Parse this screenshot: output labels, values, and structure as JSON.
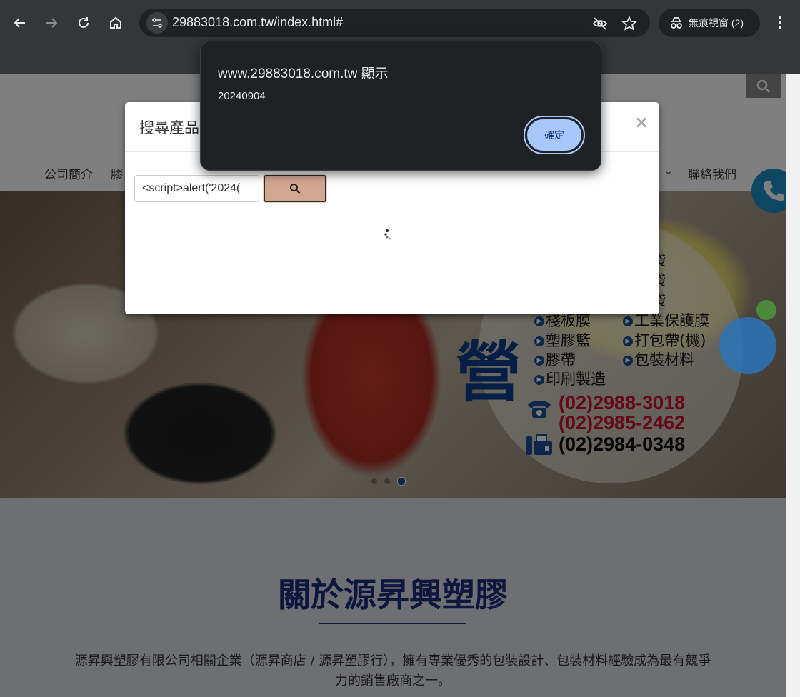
{
  "browser": {
    "url": "29883018.com.tw/index.html#",
    "incognito_label": "無痕視窗 (2)",
    "icons": [
      "back-icon",
      "forward-icon",
      "reload-icon",
      "home-icon",
      "site-info-icon",
      "eye-off-icon",
      "star-icon",
      "incognito-icon",
      "more-icon"
    ]
  },
  "site": {
    "nav": [
      "公司簡介",
      "膠",
      "聯絡我們"
    ],
    "hero": {
      "big_char": "營",
      "products": [
        "空袋",
        "壞袋",
        "包袋",
        "棧板膜",
        "工業保護膜",
        "塑膠籃",
        "打包帶(機)",
        "膠帶",
        "包裝材料",
        "印刷製造"
      ],
      "phones": [
        "(02)2988-3018",
        "(02)2985-2462"
      ],
      "fax": "(02)2984-0348",
      "slides": 3,
      "active_slide": 3
    },
    "about": {
      "title": "關於源昇興塑膠",
      "text_line1": "源昇興塑膠有限公司相關企業（源昇商店 / 源昇塑膠行），擁有專業優秀的包裝設計、包裝材料經驗成為最有競爭",
      "text_line2": "力的銷售廠商之一。"
    }
  },
  "modal": {
    "title": "搜尋產品",
    "close": "×",
    "search_value": "<script>alert('2024(",
    "loading": true
  },
  "alert": {
    "title": "www.29883018.com.tw 顯示",
    "message": "20240904",
    "ok_label": "確定"
  },
  "colors": {
    "chrome_bg": "#35363a",
    "alert_bg": "#202124",
    "alert_button": "#a8c7fa",
    "search_button": "#d2a791",
    "about_title": "#1a2d7a",
    "phone_red": "#c8102e"
  }
}
